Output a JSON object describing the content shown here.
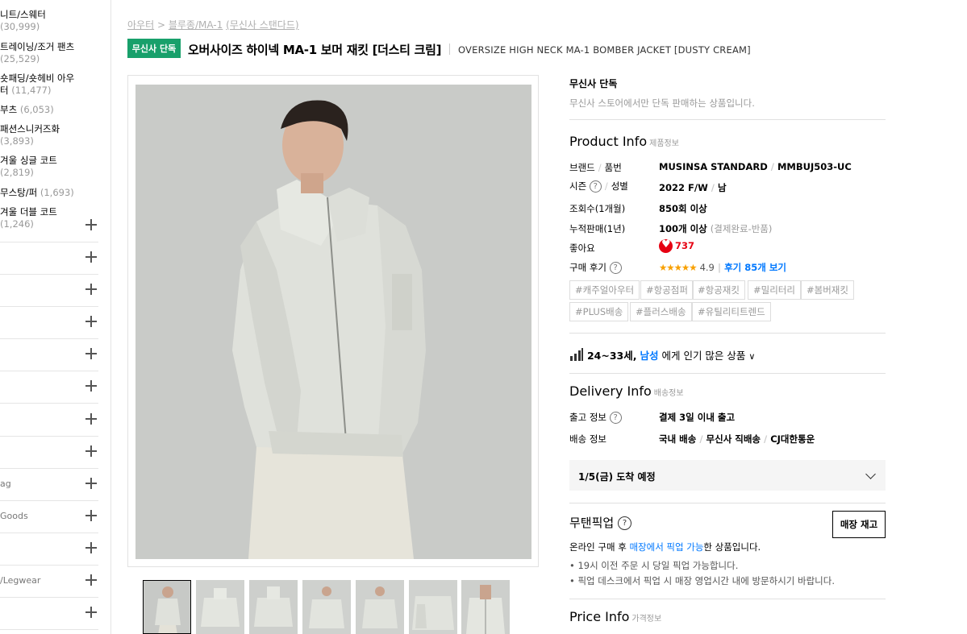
{
  "sidebar": {
    "categories": [
      {
        "label": "니트/스웨터",
        "count": "(30,999)"
      },
      {
        "label": "트레이닝/조거 팬츠",
        "count": "(25,529)"
      },
      {
        "label": "숏패딩/숏헤비 아우",
        "label2": "터",
        "count": "(11,477)"
      },
      {
        "label": "부츠",
        "count": "(6,053)"
      },
      {
        "label": "패션스니커즈화",
        "count": "(3,893)"
      },
      {
        "label": "겨울 싱글 코트",
        "count": "(2,819)"
      },
      {
        "label": "무스탕/퍼",
        "count": "(1,693)"
      },
      {
        "label": "겨울 더블 코트",
        "count": "(1,246)"
      }
    ],
    "sections": [
      "",
      "",
      "",
      "",
      "",
      "",
      "",
      "",
      "ag",
      "Goods",
      "",
      "/Legwear",
      ""
    ]
  },
  "breadcrumb": {
    "first": "아우터",
    "sep": ">",
    "second": "블루종/MA-1",
    "third": "(무신사 스탠다드)"
  },
  "header": {
    "badge": "무신사 단독",
    "title": "오버사이즈 하이넥 MA-1 보머 재킷 [더스티 크림]",
    "subtitle": "OVERSIZE HIGH NECK MA-1 BOMBER JACKET [DUSTY CREAM]"
  },
  "exclusive": {
    "title": "무신사 단독",
    "desc": "무신사 스토어에서만 단독 판매하는 상품입니다."
  },
  "product_info": {
    "title": "Product Info",
    "title_ko": "제품정보",
    "brand_label": "브랜드",
    "code_label": "품번",
    "brand": "MUSINSA STANDARD",
    "code": "MMBUJ503-UC",
    "season_label": "시즌",
    "gender_label": "성별",
    "season": "2022 F/W",
    "gender": "남",
    "views_label": "조회수(1개월)",
    "views": "850회 이상",
    "sales_label": "누적판매(1년)",
    "sales": "100개 이상",
    "sales_note": "(결제완료-반품)",
    "likes_label": "좋아요",
    "likes": "737",
    "review_label": "구매 후기",
    "stars": "★★★★★",
    "rating": "4.9",
    "review_link": "후기 85개 보기",
    "tags": [
      "#캐주얼아우터",
      "#항공점퍼",
      "#항공재킷",
      "#밀리터리",
      "#봄버재킷",
      "#PLUS배송",
      "#플러스배송",
      "#유틸리티트렌드"
    ]
  },
  "popular": {
    "age": "24~33세",
    "comma": ",",
    "gender": "남성",
    "suffix": "에게 인기 많은 상품"
  },
  "delivery_info": {
    "title": "Delivery Info",
    "title_ko": "배송정보",
    "ship_label": "출고 정보",
    "ship_value": "결제 3일 이내 출고",
    "method_label": "배송 정보",
    "method1": "국내 배송",
    "method2": "무신사 직배송",
    "method3": "CJ대한통운",
    "arrival": "1/5(금) 도착 예정"
  },
  "pickup": {
    "title": "무탠픽업",
    "store_button": "매장 재고",
    "desc_pre": "온라인 구매 후 ",
    "desc_link": "매장에서 픽업 가능",
    "desc_post": "한 상품입니다.",
    "bullet1": "•  19시 이전 주문 시 당일 픽업 가능합니다.",
    "bullet2": "•  픽업 데스크에서 픽업 시 매장 영업시간 내에 방문하시기 바랍니다."
  },
  "price_info": {
    "title": "Price Info",
    "title_ko": "가격정보"
  },
  "colors": {
    "badge": "#18a06b",
    "accent_blue": "#0078ff",
    "like_red": "#e60012",
    "star": "#f8a000"
  }
}
